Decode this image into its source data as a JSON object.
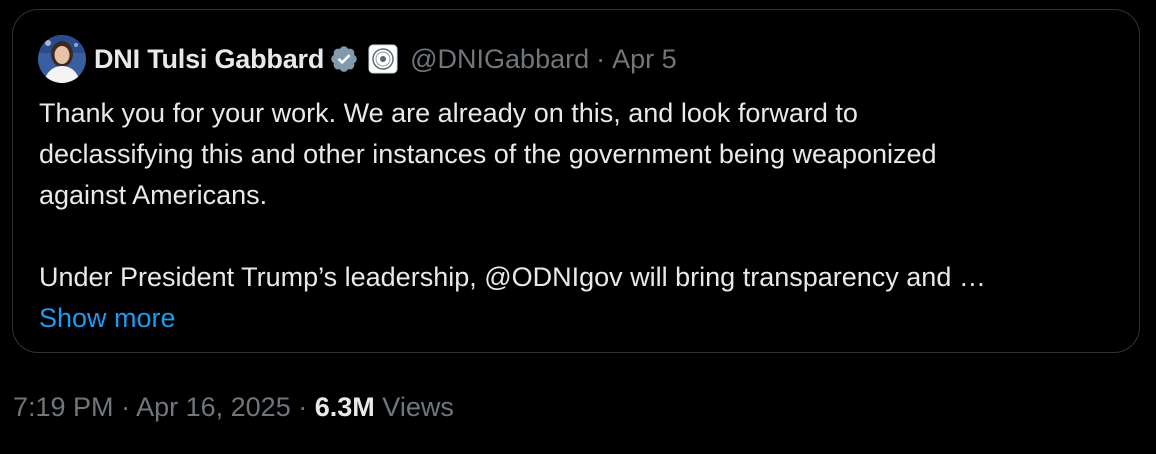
{
  "quoted_post": {
    "author": {
      "display_name": "DNI Tulsi Gabbard",
      "handle": "@DNIGabbard",
      "verified_badge_icon": "verified-badge-icon",
      "affiliate_badge_icon": "government-seal-icon",
      "avatar_icon": "profile-photo-avatar"
    },
    "date_separator": "·",
    "date": "Apr 5",
    "text_lines": [
      "Thank you for your work. We are already on this, and look forward to",
      "declassifying this and other instances of the government being weaponized",
      "against Americans.",
      "",
      "Under President Trump’s leadership, @ODNIgov will bring transparency and …"
    ],
    "show_more_label": "Show more"
  },
  "post_meta": {
    "time": "7:19 PM",
    "separator1": "·",
    "date": "Apr 16, 2025",
    "separator2": "·",
    "views_count": "6.3M",
    "views_label": "Views"
  },
  "colors": {
    "background": "#000000",
    "border": "#2f3336",
    "primary_text": "#e7e9ea",
    "secondary_text": "#71767b",
    "link": "#1d9bf0",
    "verified_badge": "#829aab"
  }
}
